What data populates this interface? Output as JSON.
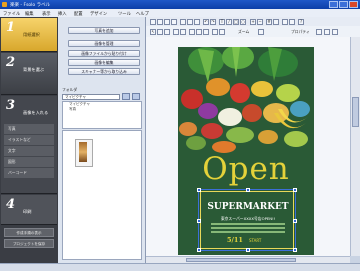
{
  "window": {
    "title": "楽楽 - Fsolo ラベル"
  },
  "menu": [
    "ファイル",
    "編集",
    "表示",
    "挿入",
    "配置",
    "デザイン",
    "ツール",
    "ヘルプ"
  ],
  "steps": [
    {
      "num": "1",
      "label": "用紙選択"
    },
    {
      "num": "2",
      "label": "背景を選ぶ"
    },
    {
      "num": "3",
      "label": "画像を入れる",
      "subitems": [
        "写真",
        "イラストなど",
        "文字",
        "図形",
        "バーコード"
      ]
    },
    {
      "num": "4",
      "label": "印刷"
    }
  ],
  "sidebar_bottom": [
    "作成手順の表示",
    "プロジェクトを保存"
  ],
  "panel": {
    "buttons": [
      "写真を追加",
      "画像を管理",
      "画像ファイルから貼り付け",
      "画像を編集",
      "スキャナー等から取り込み"
    ],
    "folder_label": "フォルダ",
    "folder_value": "マイピクチャ",
    "folder_items": [
      "マイピクチャ",
      "写真"
    ]
  },
  "toolbar": {
    "zoom_label": "ズーム",
    "props_label": "プロパティ"
  },
  "poster": {
    "open_text": "Open",
    "sm_title": "SUPERMARKET",
    "sm_sub": "東京スーパーXXXX号店OPEN!!",
    "sm_date": "5/11",
    "sm_start": "START"
  },
  "status": {
    "text": ""
  }
}
